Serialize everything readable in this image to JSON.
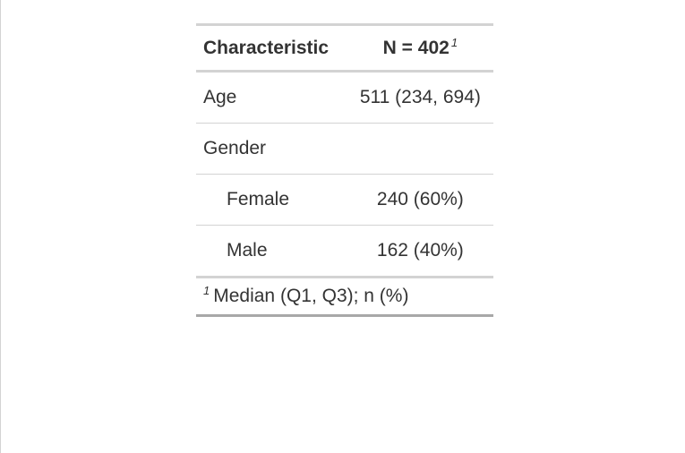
{
  "table": {
    "header": {
      "characteristic": "Characteristic",
      "n_label": "N = 402",
      "n_footnote_mark": "1"
    },
    "rows": [
      {
        "label": "Age",
        "value": "511 (234, 694)",
        "indent": false
      },
      {
        "label": "Gender",
        "value": "",
        "indent": false
      },
      {
        "label": "Female",
        "value": "240 (60%)",
        "indent": true
      },
      {
        "label": "Male",
        "value": "162 (40%)",
        "indent": true
      }
    ],
    "footnote": {
      "mark": "1",
      "text": "Median (Q1, Q3); n (%)"
    }
  }
}
